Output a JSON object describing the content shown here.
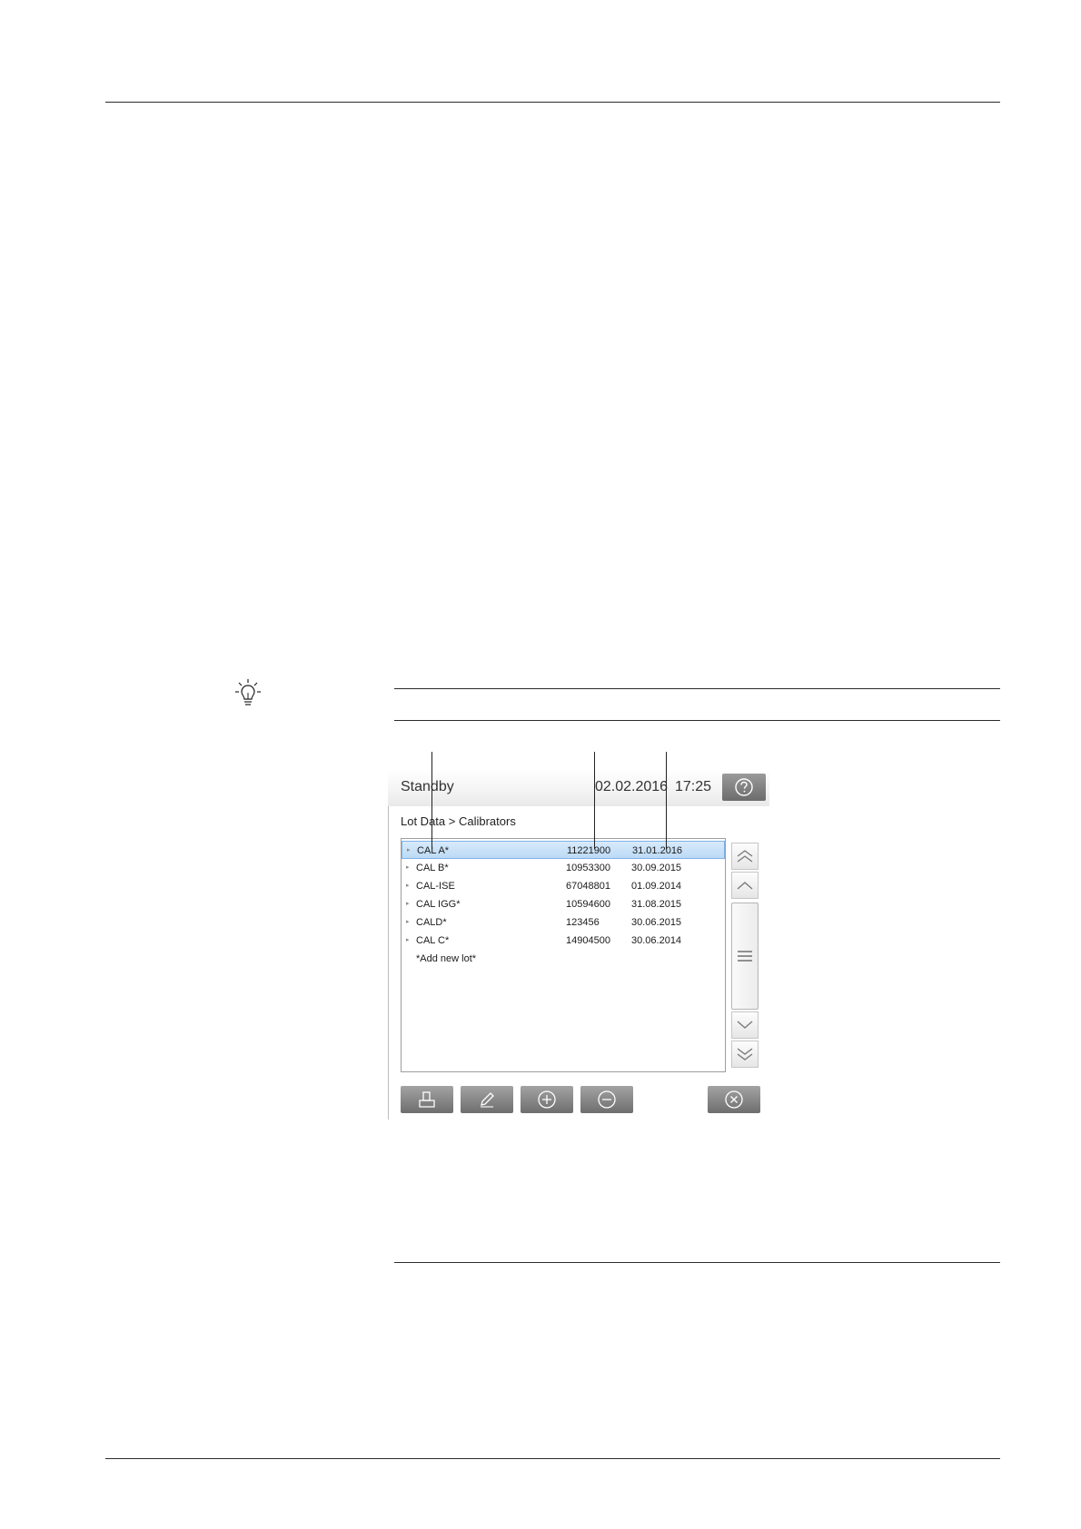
{
  "screen": {
    "status": "Standby",
    "date": "02.02.2016",
    "time": "17:25",
    "breadcrumb": "Lot Data > Calibrators"
  },
  "lots": [
    {
      "name": "CAL A*",
      "lot": "11221900",
      "expiry": "31.01.2016",
      "selected": true
    },
    {
      "name": "CAL B*",
      "lot": "10953300",
      "expiry": "30.09.2015"
    },
    {
      "name": "CAL-ISE",
      "lot": "67048801",
      "expiry": "01.09.2014"
    },
    {
      "name": "CAL IGG*",
      "lot": "10594600",
      "expiry": "31.08.2015"
    },
    {
      "name": "CALD*",
      "lot": "123456",
      "expiry": "30.06.2015"
    },
    {
      "name": "CAL C*",
      "lot": "14904500",
      "expiry": "30.06.2014"
    }
  ],
  "add_new_label": "*Add new lot*",
  "icons": {
    "tip": "lightbulb-icon",
    "help": "question-icon",
    "print": "print-icon",
    "edit": "pencil-icon",
    "add": "plus-circle-icon",
    "remove": "minus-circle-icon",
    "close": "close-circle-icon",
    "scroll_top": "double-chevron-up-icon",
    "scroll_up": "chevron-up-icon",
    "scroll_thumb": "grip-icon",
    "scroll_down": "chevron-down-icon",
    "scroll_bottom": "double-chevron-down-icon"
  },
  "colors": {
    "selection": "#bcdaf5",
    "toolbar_button": "#7a7a7a"
  }
}
